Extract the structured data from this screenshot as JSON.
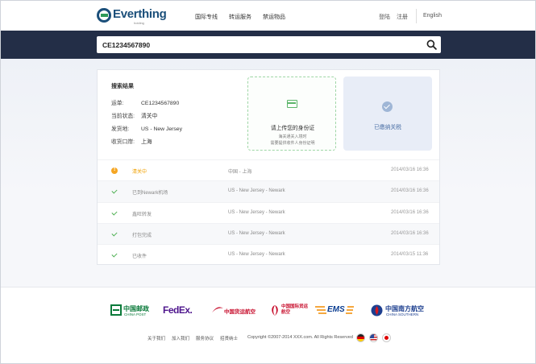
{
  "header": {
    "logo_text": "Everthing",
    "logo_sub": "holding",
    "nav": [
      "国际专线",
      "转运服务",
      "禁运物品"
    ],
    "login": "登陆",
    "register": "注册",
    "language": "English"
  },
  "search": {
    "value": "CE1234567890"
  },
  "result": {
    "title": "搜索结果",
    "fields": [
      {
        "label": "运单:",
        "value": "CE1234567890"
      },
      {
        "label": "当前状态:",
        "value": "清关中"
      },
      {
        "label": "发货地:",
        "value": "US - New Jersey"
      },
      {
        "label": "收货口岸:",
        "value": "上海"
      }
    ],
    "upload": {
      "title": "请上传您的身份证",
      "note_line1": "海关通关入境时",
      "note_line2": "需要提供收件人身份证明"
    },
    "paid": {
      "text": "已缴纳关税"
    }
  },
  "tracking": [
    {
      "status": "清关中",
      "location": "中国 - 上海",
      "time": "2014/03/16 16:36",
      "icon": "warning-icon"
    },
    {
      "status": "已到Newark机场",
      "location": "US - New Jersey - Newark",
      "time": "2014/03/16 16:36",
      "icon": "check-icon"
    },
    {
      "status": "鑫旺转发",
      "location": "US - New Jersey - Newark",
      "time": "2014/03/16 16:36",
      "icon": "check-icon"
    },
    {
      "status": "打包完成",
      "location": "US - New Jersey - Newark",
      "time": "2014/03/16 16:36",
      "icon": "check-icon"
    },
    {
      "status": "已收件",
      "location": "US - New Jersey - Newark",
      "time": "2014/03/15 11:36",
      "icon": "check-icon"
    }
  ],
  "partners": [
    "中国邮政",
    "CHINA POST",
    "FedEx.",
    "中国货运航空",
    "中国国际货运航空",
    "EMS",
    "中国南方航空",
    "CHINA SOUTHERN"
  ],
  "footer": {
    "links": [
      "关于我们",
      "加入我们",
      "服务协议",
      "招贤纳士"
    ],
    "copyright": "Copyright ©2007-2014 XXX.com. All Rights Reserved"
  },
  "colors": {
    "brand": "#1b4f7a",
    "band": "#232e47",
    "warning": "#f5a623",
    "success": "#4caf50"
  }
}
